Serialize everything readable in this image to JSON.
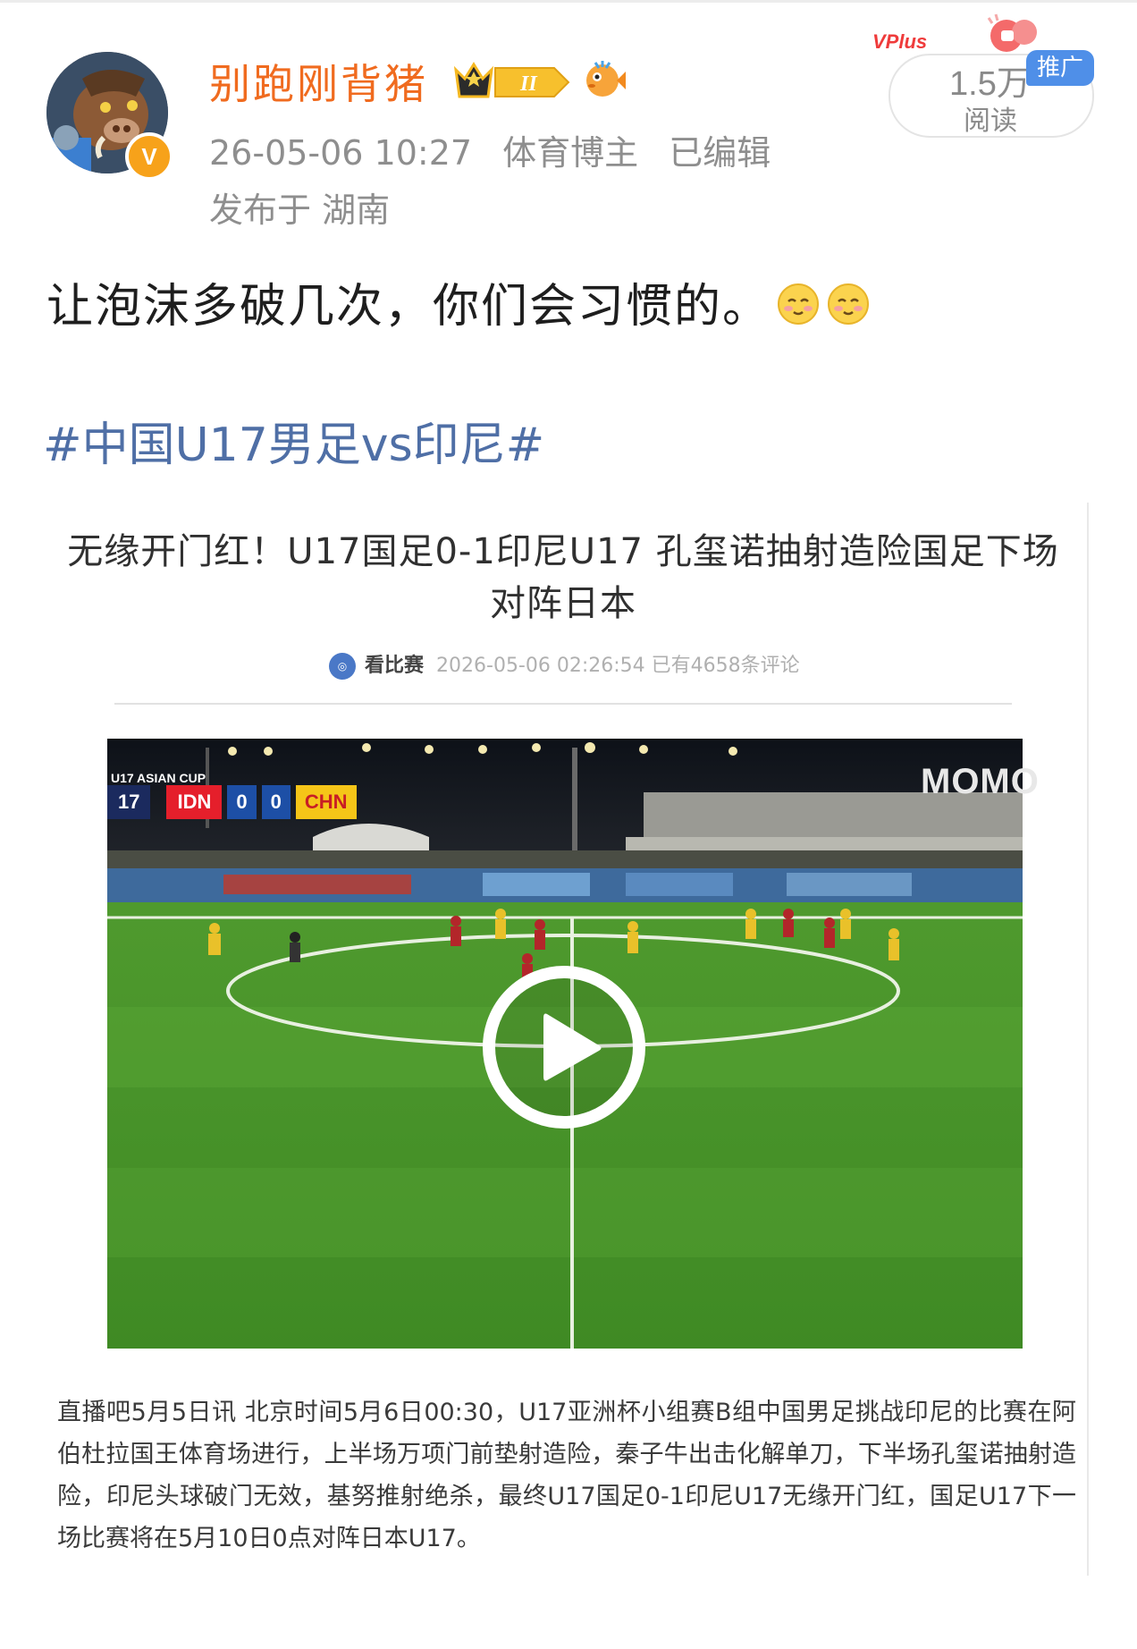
{
  "post": {
    "author": "别跑刚背猪",
    "verified_badge": "V",
    "level_badge": "II",
    "timestamp": "26-05-06 10:27",
    "author_tag": "体育博主",
    "edited": "已编辑",
    "location": "发布于 湖南",
    "reads_count": "1.5万",
    "reads_label": "阅读",
    "promo_tag": "推广",
    "vplus_label": "VPlus",
    "text": "让泡沫多破几次，你们会习惯的。",
    "emoji_icons": [
      "blushing-face-icon",
      "blushing-face-icon"
    ],
    "hashtag": "#中国U17男足vs印尼#"
  },
  "article": {
    "title_line1": "无缘开门红！U17国足0-1印尼U17 孔玺诺抽射造险国足下场",
    "title_line2": "对阵日本",
    "source": "看比赛",
    "publish_time": "2026-05-06 02:26:54",
    "comments": "已有4658条评论",
    "video": {
      "competition_label": "U17 ASIAN CUP",
      "match_time": "17",
      "team_left": "IDN",
      "score_left": "0",
      "score_right": "0",
      "team_right": "CHN",
      "broadcaster": "MOMO"
    },
    "body": "直播吧5月5日讯 北京时间5月6日00:30，U17亚洲杯小组赛B组中国男足挑战印尼的比赛在阿伯杜拉国王体育场进行，上半场万项门前垫射造险，秦子牛出击化解单刀，下半场孔玺诺抽射造险，印尼头球破门无效，基努推射绝杀，最终U17国足0-1印尼U17无缘开门红，国足U17下一场比赛将在5月10日0点对阵日本U17。"
  },
  "colors": {
    "username": "#f06b1f",
    "hashtag": "#4f6fa6",
    "promo": "#4f8fe8",
    "badge": "#f7a21a"
  }
}
